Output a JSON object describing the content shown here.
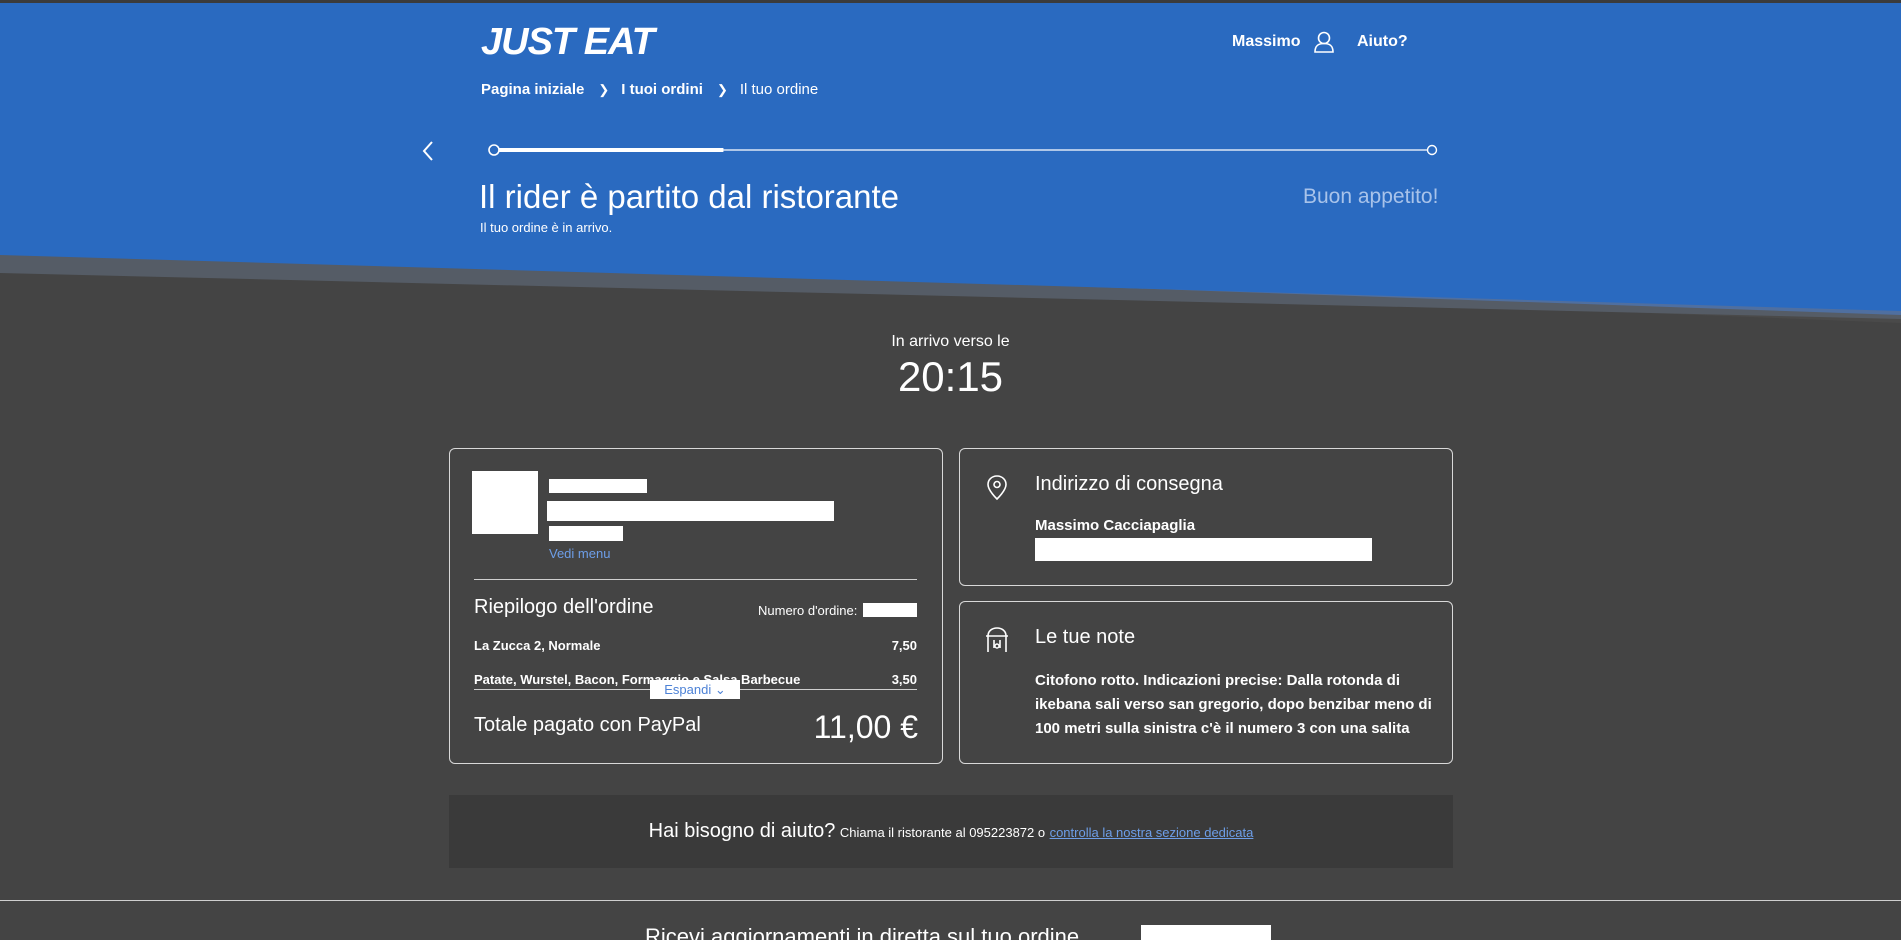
{
  "header": {
    "logo": "JUST EAT",
    "user_name": "Massimo",
    "help_link": "Aiuto?",
    "colors": {
      "brand_blue": "#2a6ac0",
      "background": "#444444"
    }
  },
  "breadcrumb": {
    "home": "Pagina iniziale",
    "orders": "I tuoi ordini",
    "current": "Il tuo ordine"
  },
  "status": {
    "title": "Il rider è partito dal ristorante",
    "subtitle": "Il tuo ordine è in arrivo.",
    "final_step": "Buon appetito!",
    "progress_fraction": 0.28
  },
  "eta": {
    "label": "In arrivo verso le",
    "time": "20:15"
  },
  "order": {
    "view_menu": "Vedi menu",
    "summary_title": "Riepilogo dell'ordine",
    "order_number_label": "Numero d'ordine:",
    "items": [
      {
        "name": "La Zucca 2, Normale",
        "price": "7,50"
      },
      {
        "name": "Patate, Wurstel, Bacon, Formaggio e Salsa Barbecue",
        "price": "3,50"
      }
    ],
    "expand_label": "Espandi",
    "total_label": "Totale pagato con PayPal",
    "total_value": "11,00 €"
  },
  "address": {
    "heading": "Indirizzo di consegna",
    "name": "Massimo Cacciapaglia"
  },
  "notes": {
    "heading": "Le tue note",
    "text": "Citofono rotto. Indicazioni precise: Dalla rotonda di ikebana sali verso san gregorio, dopo benzibar meno di 100 metri sulla sinistra c'è il numero 3 con una salita"
  },
  "help": {
    "question": "Hai bisogno di aiuto?",
    "call_text": "Chiama il ristorante al 095223872 o",
    "link_text": "controlla la nostra sezione dedicata"
  },
  "footer": {
    "live_updates": "Ricevi aggiornamenti in diretta sul tuo ordine"
  }
}
